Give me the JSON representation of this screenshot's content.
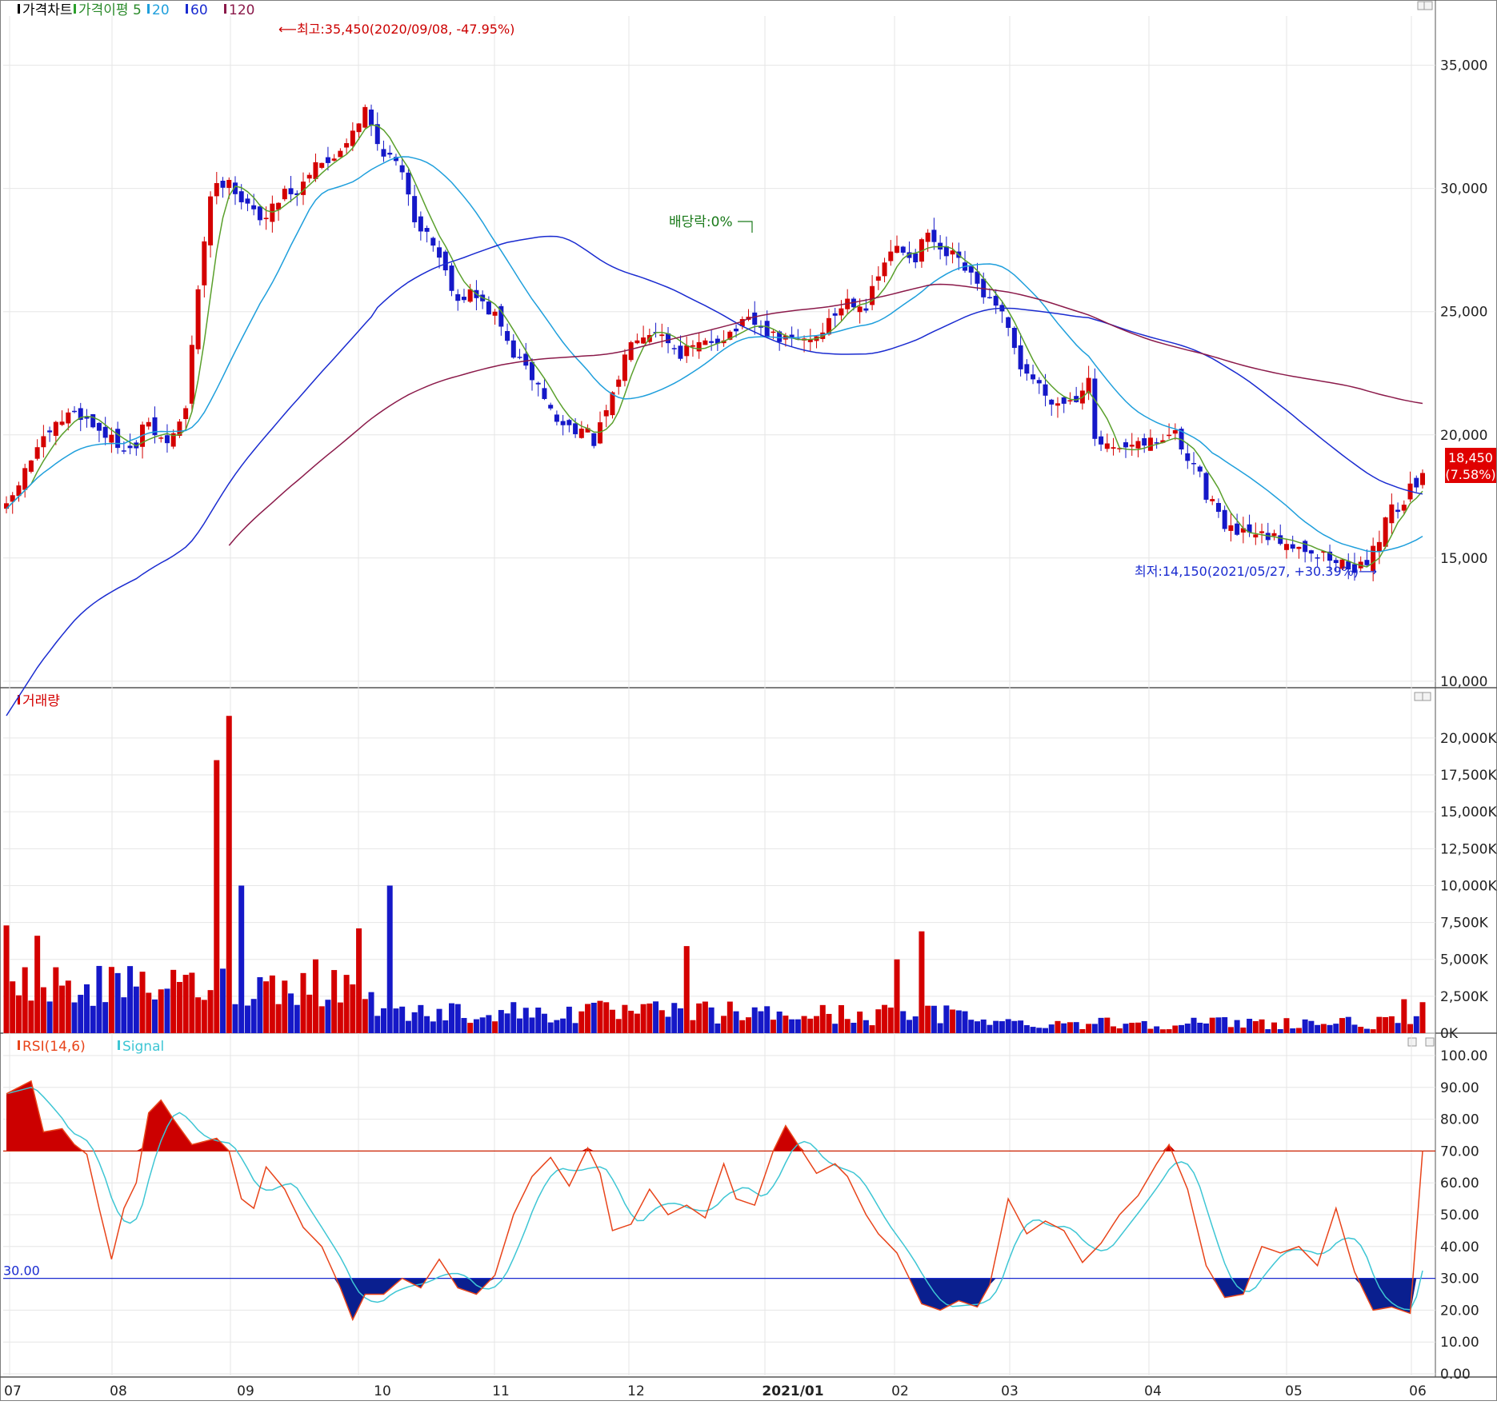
{
  "panels": {
    "price": {
      "legend": [
        {
          "marker": "#000000",
          "text": "가격차트",
          "color": "#000000"
        },
        {
          "marker": "#2ca02c",
          "text": "가격이평 5",
          "color": "#2a8a2a"
        },
        {
          "marker": "#1f9fdc",
          "text": "20",
          "color": "#1f9fdc"
        },
        {
          "marker": "#1a2bd0",
          "text": "60",
          "color": "#1a2bd0"
        },
        {
          "marker": "#8b1a4a",
          "text": "120",
          "color": "#8b1a4a"
        }
      ],
      "y_ticks": [
        "35,000",
        "30,000",
        "25,000",
        "20,000",
        "15,000",
        "10,000"
      ],
      "high_note": "최고:35,450(2020/09/08, -47.95%)",
      "low_note": "최저:14,150(2021/05/27, +30.39%)",
      "dividend_note": "배당락:0%",
      "last_price": "18,450",
      "last_change": "(7.58%)"
    },
    "volume": {
      "legend": [
        {
          "marker": "#d40000",
          "text": "거래량",
          "color": "#d40000"
        }
      ],
      "y_ticks": [
        "20,000K",
        "17,500K",
        "15,000K",
        "12,500K",
        "10,000K",
        "7,500K",
        "5,000K",
        "2,500K",
        "0K"
      ]
    },
    "rsi": {
      "legend": [
        {
          "marker": "#e8441a",
          "text": "RSI(14,6)",
          "color": "#e8441a"
        },
        {
          "marker": "#3ec6d4",
          "text": "Signal",
          "color": "#3ec6d4"
        }
      ],
      "y_ticks": [
        "100.00",
        "90.00",
        "80.00",
        "70.00",
        "60.00",
        "50.00",
        "40.00",
        "30.00",
        "20.00",
        "10.00",
        "0.00"
      ],
      "level_30_label": "30.00"
    }
  },
  "x_axis": {
    "labels": [
      "07",
      "08",
      "09",
      "10",
      "11",
      "12",
      "2021/01",
      "02",
      "03",
      "04",
      "05",
      "06"
    ]
  },
  "chart_data": [
    {
      "type": "candlestick",
      "x_labels": [
        "07",
        "08",
        "09",
        "10",
        "11",
        "12",
        "2021/01",
        "02",
        "03",
        "04",
        "05",
        "06"
      ],
      "ylim": [
        9800,
        37000
      ],
      "y_tick_values": [
        35000,
        30000,
        25000,
        20000,
        15000,
        10000
      ],
      "sample_closes": [
        17500,
        19500,
        31000,
        28000,
        20000,
        24000,
        27000,
        23000,
        20000,
        20000,
        16000,
        18450
      ],
      "highest": {
        "value": 35450,
        "date": "2020/09/08"
      },
      "lowest": {
        "value": 14150,
        "date": "2021/05/27"
      },
      "last": {
        "value": 18450,
        "change_pct": 7.58
      },
      "moving_average_periods": [
        5,
        20,
        60,
        120
      ],
      "colors": {
        "up": "#d40000",
        "down": "#1518c8",
        "ma5": "#5aa02c",
        "ma20": "#1f9fdc",
        "ma60": "#1a2bd0",
        "ma120": "#8b1a4a"
      }
    },
    {
      "type": "bar",
      "name": "거래량",
      "unit": "K",
      "ylim": [
        0,
        22000
      ],
      "y_tick_values": [
        20000,
        17500,
        15000,
        12500,
        10000,
        7500,
        5000,
        2500,
        0
      ],
      "peaks": [
        {
          "month": "08",
          "value": 21500
        },
        {
          "month": "08",
          "value": 18500
        },
        {
          "month": "09",
          "value": 10000
        },
        {
          "month": "2021/01",
          "value": 6900
        },
        {
          "month": "11",
          "value": 5900
        },
        {
          "month": "12",
          "value": 5000
        }
      ],
      "colors": {
        "up": "#d40000",
        "down": "#1518c8"
      }
    },
    {
      "type": "line",
      "name": "RSI(14,6)",
      "series": [
        {
          "name": "RSI(14,6)"
        },
        {
          "name": "Signal"
        }
      ],
      "ylim": [
        0,
        100
      ],
      "y_tick_values": [
        100,
        90,
        80,
        70,
        60,
        50,
        40,
        30,
        20,
        10,
        0
      ],
      "levels": [
        70,
        30
      ],
      "last_values": {
        "RSI(14,6)": 70,
        "Signal": 56
      },
      "colors": {
        "rsi": "#e8441a",
        "signal": "#3ec6d4",
        "overbought_fill": "#cc0000",
        "oversold_fill": "#0a1f8f"
      }
    }
  ]
}
